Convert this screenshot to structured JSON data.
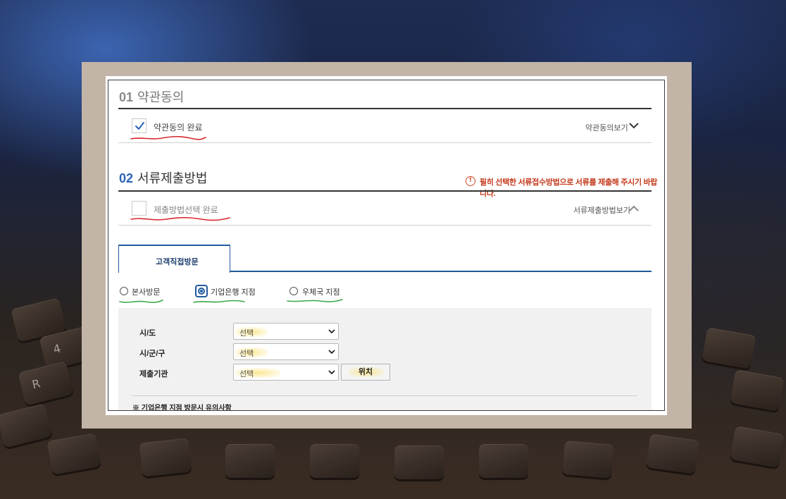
{
  "step1": {
    "number": "01",
    "title": "약관동의",
    "checkbox_label": "약관동의 완료",
    "checked": true,
    "view_link": "약관동의보기"
  },
  "step2": {
    "number": "02",
    "title": "서류제출방법",
    "notice_icon": "!",
    "notice": "필히 선택한 서류접수방법으로 서류를 제출해 주시기 바랍니다.",
    "checkbox_label": "제출방법선택 완료",
    "checked": false,
    "view_link": "서류제출방법보기"
  },
  "tab": {
    "label": "고객직접방문"
  },
  "radios": [
    {
      "label": "본사방문",
      "selected": false
    },
    {
      "label": "기업은행 지점",
      "selected": true
    },
    {
      "label": "우체국 지점",
      "selected": false
    }
  ],
  "form": {
    "fields": [
      {
        "label": "시/도",
        "value": "선택"
      },
      {
        "label": "시/군/구",
        "value": "선택"
      },
      {
        "label": "제출기관",
        "value": "선택"
      }
    ],
    "location_button": "위치",
    "note": "※ 기업은행 지점 방문시 유의사항"
  },
  "colors": {
    "accent_blue": "#1f5a9b",
    "step2_blue": "#2b63b6",
    "notice_red": "#c43a1d",
    "annotation_red": "#d7262e",
    "annotation_green": "#3aa845",
    "highlight_yellow": "#fae68c"
  },
  "icons": {
    "checkmark": "check-icon",
    "chevron_down": "chevron-down-icon",
    "chevron_up": "chevron-up-icon",
    "notice": "info-icon"
  },
  "keyboard_keys": [
    "4",
    "R"
  ]
}
